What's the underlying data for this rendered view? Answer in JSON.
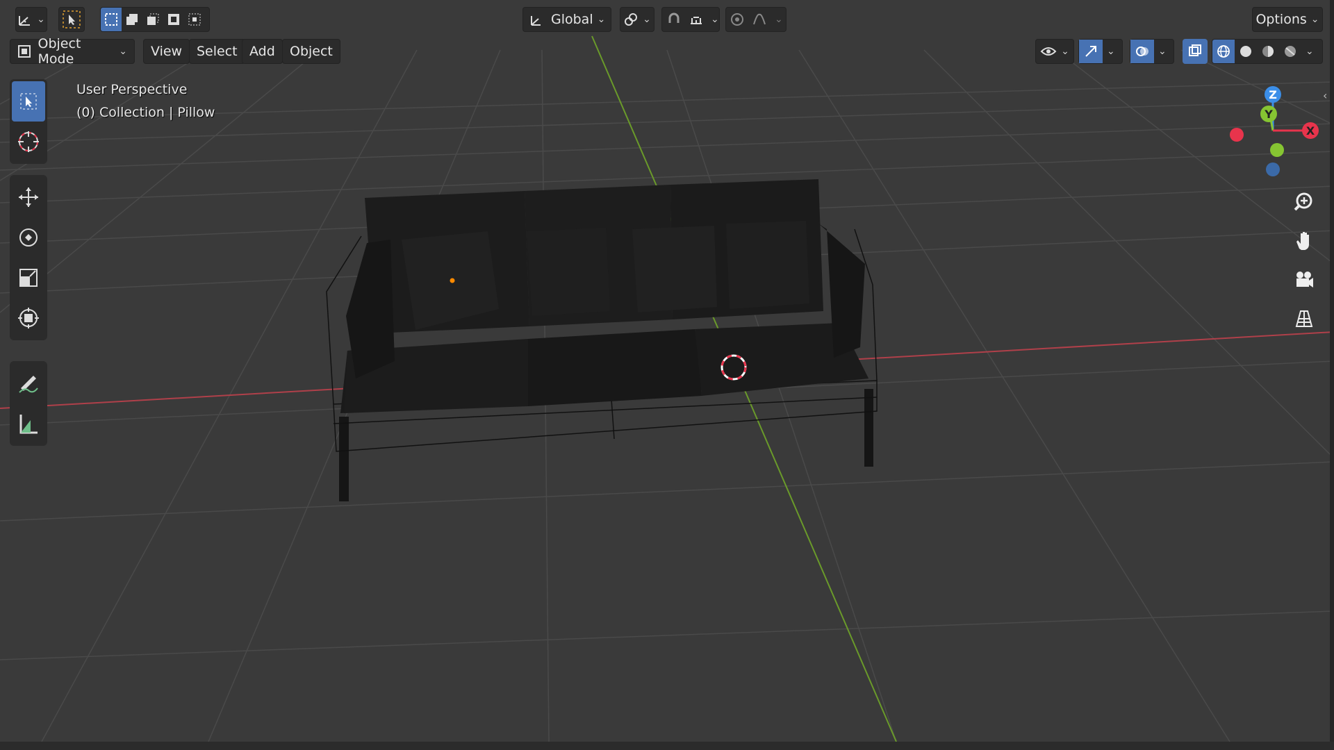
{
  "header": {
    "transform_orientation": "Global",
    "options_label": "Options"
  },
  "menubar": {
    "mode_label": "Object Mode",
    "menus": [
      "View",
      "Select",
      "Add",
      "Object"
    ]
  },
  "viewport": {
    "view_name": "User Perspective",
    "collection_info": "(0) Collection | Pillow"
  },
  "gizmo": {
    "axes": [
      "Z",
      "Y",
      "X"
    ],
    "colors": {
      "x": "#e8344c",
      "y": "#86c532",
      "z": "#3b8ee8"
    }
  },
  "colors": {
    "accent": "#4772b3",
    "grid_bg": "#3a3a3a",
    "x_axis": "#b0404a",
    "y_axis": "#6a9a2a",
    "origin_dot": "#ff8a00",
    "cursor_red": "#e8344c"
  },
  "tools": [
    "select-box-icon",
    "cursor-icon",
    "move-icon",
    "rotate-icon",
    "scale-icon",
    "transform-icon",
    "annotate-icon",
    "measure-icon"
  ],
  "nav_buttons": [
    "zoom-icon",
    "pan-hand-icon",
    "camera-icon",
    "grid-view-icon"
  ]
}
